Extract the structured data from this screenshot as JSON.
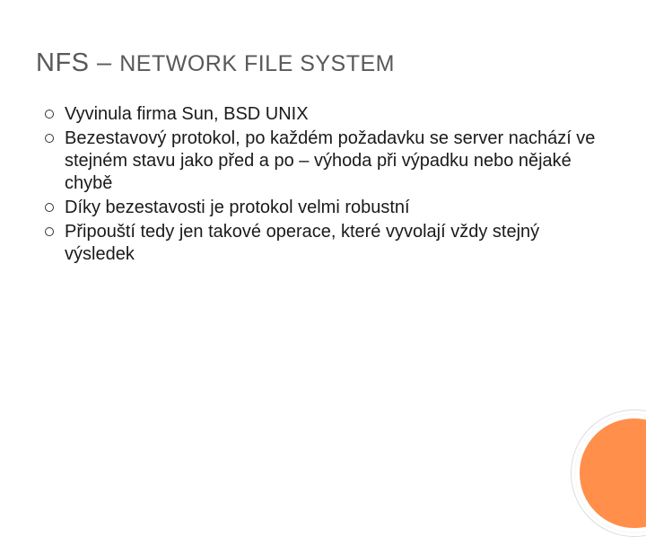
{
  "title": {
    "prefix": "NFS",
    "dash": " – ",
    "rest": "NETWORK FILE SYSTEM"
  },
  "bullets": [
    "Vyvinula firma Sun, BSD UNIX",
    "Bezestavový protokol, po každém požadavku se server nachází ve stejném stavu jako před a po – výhoda při výpadku nebo nějaké chybě",
    "Díky bezestavosti je protokol velmi robustní",
    "Připouští tedy jen takové operace, které vyvolají vždy stejný výsledek"
  ]
}
